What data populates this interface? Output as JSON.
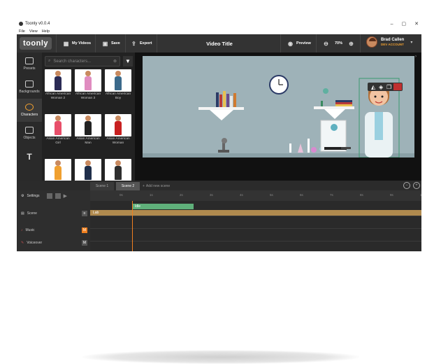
{
  "app": {
    "title": "Toonly v0.0.4"
  },
  "window_controls": {
    "minimize": "–",
    "maximize": "▢",
    "close": "✕"
  },
  "menu": [
    "File",
    "View",
    "Help"
  ],
  "toolbar": {
    "brand": "toonly",
    "my_videos": "My Videos",
    "save": "Save",
    "export": "Export",
    "video_title": "Video Title",
    "preview": "Preview",
    "zoom": "70%"
  },
  "user": {
    "name": "Brad Callen",
    "account": "DEV ACCOUNT"
  },
  "sidebar": [
    {
      "label": "Presets",
      "icon": "presets-icon"
    },
    {
      "label": "Backgrounds",
      "icon": "backgrounds-icon"
    },
    {
      "label": "Characters",
      "icon": "characters-icon",
      "active": true
    },
    {
      "label": "Objects",
      "icon": "objects-icon"
    },
    {
      "label": "",
      "icon": "text-icon"
    }
  ],
  "search": {
    "placeholder": "Search characters..."
  },
  "characters": [
    {
      "name": "African American Woman 2",
      "shirt": "#2b2b55",
      "pants": "#222"
    },
    {
      "name": "African American Woman 3",
      "shirt": "#e08cc0",
      "pants": "#333"
    },
    {
      "name": "African American Boy",
      "shirt": "#3b6a8b",
      "pants": "#2a2a2a"
    },
    {
      "name": "Asian American Girl",
      "shirt": "#e84f6a",
      "pants": "#333"
    },
    {
      "name": "Asian American Man",
      "shirt": "#222",
      "pants": "#111"
    },
    {
      "name": "Asian American Woman",
      "shirt": "#c82020",
      "pants": "#1a1a1a"
    },
    {
      "name": "",
      "shirt": "#f0a030",
      "pants": "#333"
    },
    {
      "name": "",
      "shirt": "#1f2e4a",
      "pants": "#333"
    },
    {
      "name": "",
      "shirt": "#2e2e2e",
      "pants": "#333"
    }
  ],
  "timeline": {
    "tabs": [
      {
        "label": "Scene 1"
      },
      {
        "label": "Scene 2",
        "active": true
      }
    ],
    "add_scene": "Add new scene",
    "settings": "Settings",
    "rows": [
      {
        "label": "Scene",
        "badge": "≡"
      },
      {
        "label": "Music",
        "badge": "M"
      },
      {
        "label": "Voiceover",
        "badge": "M"
      }
    ],
    "ticks": [
      "0s",
      "1s",
      "2s",
      "3s",
      "4s",
      "5s",
      "6s",
      "7s",
      "8s",
      "9s",
      "10s"
    ],
    "clip_idle": "Idle",
    "clip_lab": "Lab"
  },
  "colors": {
    "accent": "#f08020",
    "idle_clip": "#5fb07a",
    "lab_clip": "#b08a4e",
    "stage_bg": "#9eb2b8"
  }
}
